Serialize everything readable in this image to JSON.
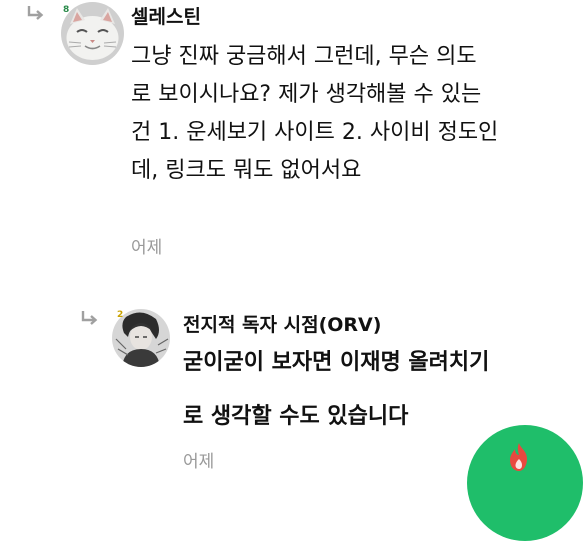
{
  "comment": {
    "nickname": "셀레스틴",
    "level": "8",
    "text_lines": [
      "그냥 진짜 궁금해서 그런데, 무슨 의도",
      "로 보이시나요? 제가 생각해볼 수 있는",
      "건 1. 운세보기 사이트 2. 사이비 정도인",
      "데, 링크도 뭐도 없어서요"
    ],
    "timestamp": "어제"
  },
  "reply": {
    "nickname": "전지적 독자 시점(ORV)",
    "level": "2",
    "text_lines": [
      "굳이굳이 보자면 이재명 올려치기",
      "로 생각할 수도 있습니다"
    ],
    "timestamp": "어제"
  },
  "colors": {
    "fab": "#1fbe6a",
    "fab_icon": "#e8493f",
    "timestamp": "#999999",
    "reply_arrow": "#a0a0a0",
    "level_badge_comment": "#2a8a4a",
    "level_badge_reply": "#c9a200"
  },
  "icons": {
    "reply_arrow": "reply-arrow-icon",
    "fab": "fire-icon"
  }
}
